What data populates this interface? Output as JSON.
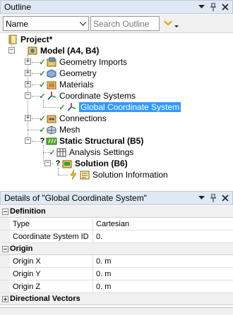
{
  "outline": {
    "title": "Outline",
    "name_select_value": "Name",
    "search_placeholder": "Search Outline"
  },
  "tree": {
    "project": "Project*",
    "model": "Model (A4, B4)",
    "geometry_imports": "Geometry Imports",
    "geometry": "Geometry",
    "materials": "Materials",
    "coordinate_systems": "Coordinate Systems",
    "global_cs": "Global Coordinate System",
    "connections": "Connections",
    "mesh": "Mesh",
    "static_structural": "Static Structural (B5)",
    "analysis_settings": "Analysis Settings",
    "solution": "Solution (B6)",
    "solution_information": "Solution Information"
  },
  "details": {
    "title": "Details of \"Global Coordinate System\"",
    "groups": {
      "definition": "Definition",
      "origin": "Origin",
      "directional_vectors": "Directional Vectors"
    },
    "rows": {
      "type_label": "Type",
      "type_value": "Cartesian",
      "csid_label": "Coordinate System ID",
      "csid_value": "0.",
      "ox_label": "Origin X",
      "ox_value": "0. m",
      "oy_label": "Origin Y",
      "oy_value": "0. m",
      "oz_label": "Origin Z",
      "oz_value": "0. m"
    }
  },
  "icons": {
    "pin": "pin-icon",
    "close": "close-icon",
    "dropdown": "dropdown-arrow-icon",
    "filter": "filter-chevron-icon"
  },
  "colors": {
    "header_bg": "#dfe8f3",
    "selected_bg": "#3399ff",
    "check_green": "#2a9a2a",
    "bolt_yellow": "#f0c020"
  }
}
